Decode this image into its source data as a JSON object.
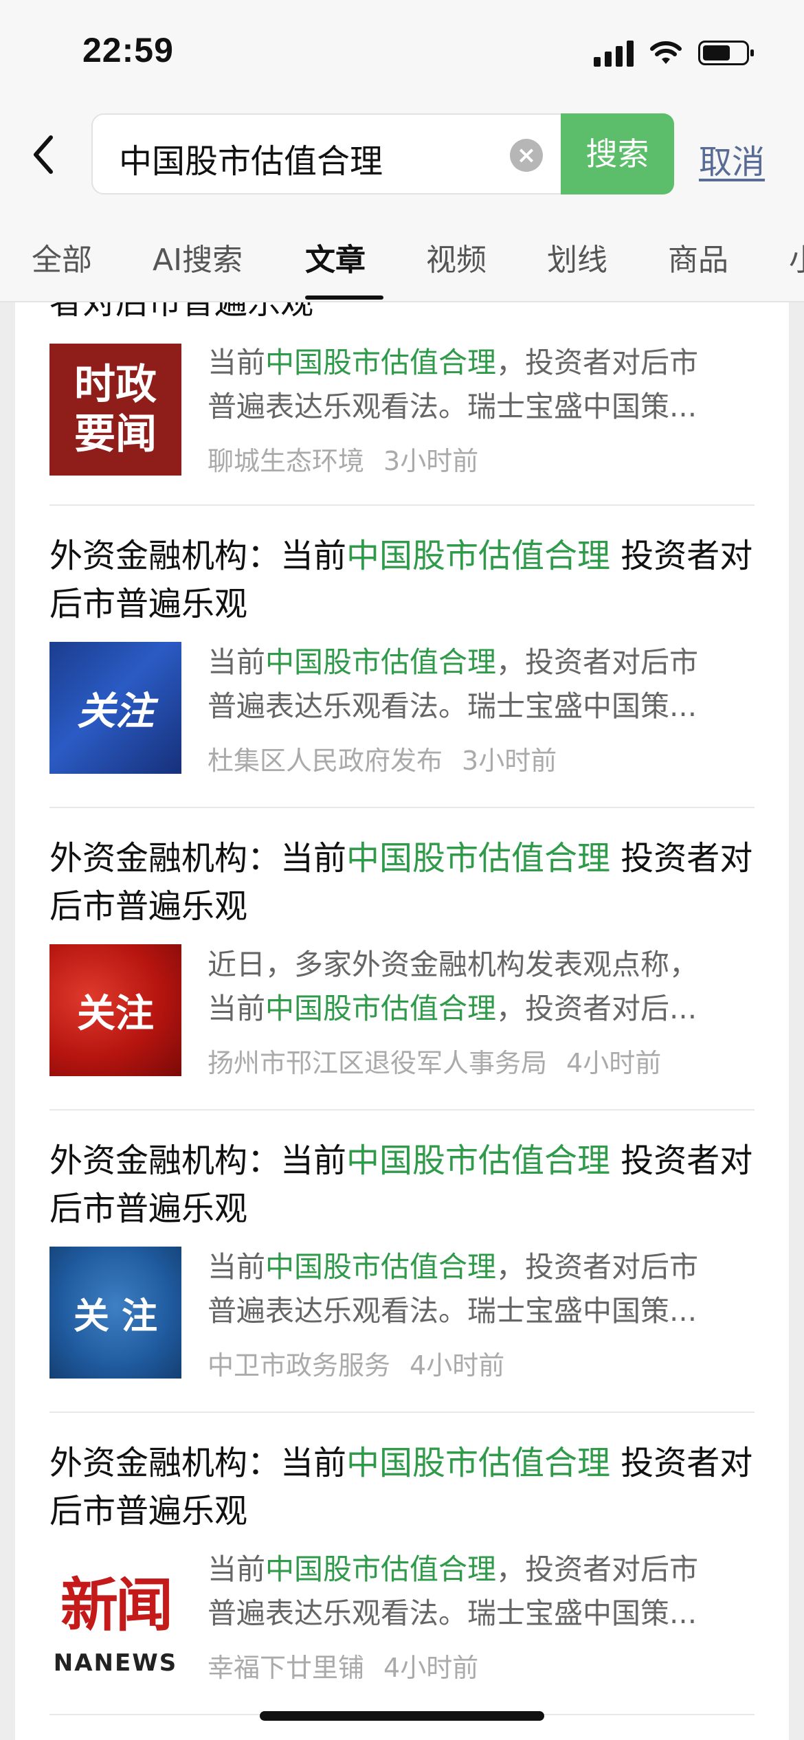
{
  "status_bar": {
    "time": "22:59"
  },
  "search": {
    "query": "中国股市估值合理",
    "search_button": "搜索",
    "cancel": "取消"
  },
  "tabs": [
    {
      "label": "全部"
    },
    {
      "label": "AI搜索"
    },
    {
      "label": "文章",
      "active": true
    },
    {
      "label": "视频"
    },
    {
      "label": "划线"
    },
    {
      "label": "商品"
    },
    {
      "label": "小"
    }
  ],
  "partial_item": {
    "title_tail": "者对后市普遍乐观",
    "thumb_text": [
      "时政",
      "要闻"
    ],
    "snippet_line1_pre": "当前",
    "snippet_line1_hl": "中国股市估值合理",
    "snippet_line1_post": "，投资者对后市",
    "snippet_line2": "普遍表达乐观看法。瑞士宝盛中国策...",
    "source": "聊城生态环境",
    "time": "3小时前"
  },
  "articles": [
    {
      "title_pre": "外资金融机构：当前",
      "title_hl": "中国股市估值合理",
      "title_post": " 投资者对后市普遍乐观",
      "thumb_text": "关注",
      "snippet_line1_pre": "当前",
      "snippet_line1_hl": "中国股市估值合理",
      "snippet_line1_post": "，投资者对后市",
      "snippet_line2": "普遍表达乐观看法。瑞士宝盛中国策...",
      "source": "杜集区人民政府发布",
      "time": "3小时前"
    },
    {
      "title_pre": "外资金融机构：当前",
      "title_hl": "中国股市估值合理",
      "title_post": " 投资者对后市普遍乐观",
      "thumb_text": "关注",
      "snippet_line1_pre": "近日，多家外资金融机构发表观点称，",
      "snippet_line1_hl": "",
      "snippet_line1_post": "",
      "snippet_line2_pre": "当前",
      "snippet_line2_hl": "中国股市估值合理",
      "snippet_line2_post": "，投资者对后...",
      "source": "扬州市邗江区退役军人事务局",
      "time": "4小时前"
    },
    {
      "title_pre": "外资金融机构：当前",
      "title_hl": "中国股市估值合理",
      "title_post": " 投资者对后市普遍乐观",
      "thumb_text": "关 注",
      "snippet_line1_pre": "当前",
      "snippet_line1_hl": "中国股市估值合理",
      "snippet_line1_post": "，投资者对后市",
      "snippet_line2": "普遍表达乐观看法。瑞士宝盛中国策...",
      "source": "中卫市政务服务",
      "time": "4小时前"
    },
    {
      "title_pre": "外资金融机构：当前",
      "title_hl": "中国股市估值合理",
      "title_post": " 投资者对后市普遍乐观",
      "thumb_text": "新闻",
      "thumb_sub": "NANEWS",
      "snippet_line1_pre": "当前",
      "snippet_line1_hl": "中国股市估值合理",
      "snippet_line1_post": "，投资者对后市",
      "snippet_line2": "普遍表达乐观看法。瑞士宝盛中国策...",
      "source": "幸福下廿里铺",
      "time": "4小时前"
    }
  ],
  "colors": {
    "accent_green": "#5cbd6a",
    "highlight_green": "#2f9a4a",
    "link_blue": "#576b95"
  }
}
